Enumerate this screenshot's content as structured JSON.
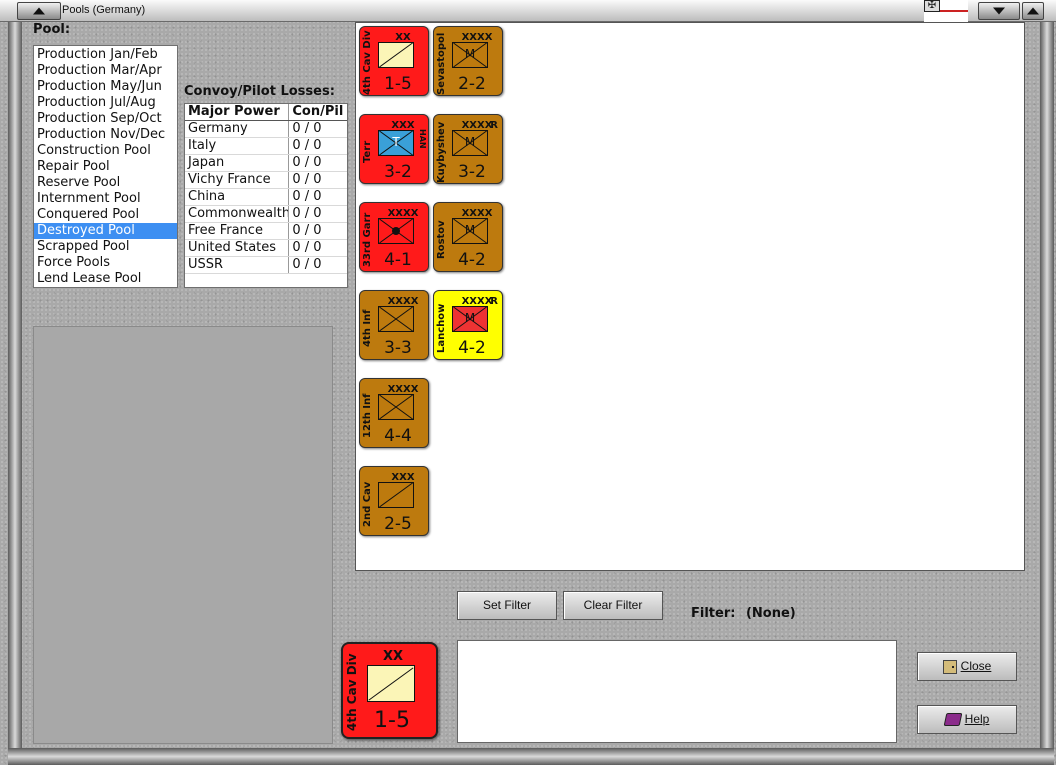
{
  "window": {
    "title": "Pools (Germany)"
  },
  "pool": {
    "label": "Pool:",
    "items": [
      {
        "label": "Production Jan/Feb"
      },
      {
        "label": "Production Mar/Apr"
      },
      {
        "label": "Production May/Jun"
      },
      {
        "label": "Production Jul/Aug"
      },
      {
        "label": "Production Sep/Oct"
      },
      {
        "label": "Production Nov/Dec"
      },
      {
        "label": "Construction Pool"
      },
      {
        "label": "Repair Pool"
      },
      {
        "label": "Reserve Pool"
      },
      {
        "label": "Internment Pool"
      },
      {
        "label": "Conquered Pool"
      },
      {
        "label": "Destroyed Pool",
        "selected": true
      },
      {
        "label": "Scrapped Pool"
      },
      {
        "label": "Force Pools"
      },
      {
        "label": "Lend Lease Pool"
      }
    ]
  },
  "losses": {
    "label": "Convoy/Pilot Losses:",
    "headers": [
      "Major Power",
      "Con/Pil"
    ],
    "rows": [
      [
        "Germany",
        "0 / 0"
      ],
      [
        "Italy",
        "0 / 0"
      ],
      [
        "Japan",
        "0 / 0"
      ],
      [
        "Vichy France",
        "0 / 0"
      ],
      [
        "China",
        "0 / 0"
      ],
      [
        "Commonwealth",
        "0 / 0"
      ],
      [
        "Free France",
        "0 / 0"
      ],
      [
        "United States",
        "0 / 0"
      ],
      [
        "USSR",
        "0 / 0"
      ]
    ]
  },
  "units": [
    {
      "name": "4th Cav Div",
      "size": "XX",
      "strength": "1-5",
      "color": "#ff1a1a"
    },
    {
      "name": "Sevastopol",
      "size": "XXXX",
      "strength": "2-2",
      "color": "#bd7a0e",
      "symbol": "M"
    },
    {
      "name": "Terr",
      "size": "XXX",
      "strength": "3-2",
      "color": "#ff1a1a",
      "symbol": "T",
      "side_label": "HAN"
    },
    {
      "name": "Kuybyshev",
      "size": "XXXX",
      "strength": "3-2",
      "color": "#bd7a0e",
      "symbol": "M",
      "mark": "R"
    },
    {
      "name": "33rd Garr",
      "size": "XXXX",
      "strength": "4-1",
      "color": "#ff1a1a"
    },
    {
      "name": "Rostov",
      "size": "XXXX",
      "strength": "4-2",
      "color": "#bd7a0e",
      "symbol": "M"
    },
    {
      "name": "4th Inf",
      "size": "XXXX",
      "strength": "3-3",
      "color": "#bd7a0e"
    },
    {
      "name": "Lanchow",
      "size": "XXXX",
      "strength": "4-2",
      "color": "#ffff00",
      "symbol": "M",
      "mark": "R"
    },
    {
      "name": "12th Inf",
      "size": "XXXX",
      "strength": "4-4",
      "color": "#bd7a0e"
    },
    {
      "name": "2nd Cav",
      "size": "XXX",
      "strength": "2-5",
      "color": "#bd7a0e"
    }
  ],
  "selected_unit": {
    "name": "4th Cav Div",
    "size": "XX",
    "strength": "1-5"
  },
  "filter": {
    "set_label": "Set Filter",
    "clear_label": "Clear Filter",
    "label": "Filter:",
    "value": "(None)"
  },
  "buttons": {
    "close": "Close",
    "help": "Help"
  }
}
